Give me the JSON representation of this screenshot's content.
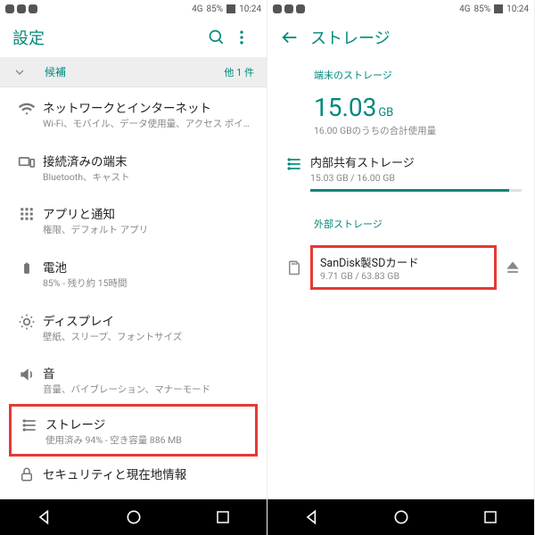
{
  "statusbar": {
    "signal": "4G",
    "battery": "85%",
    "time": "10:24"
  },
  "left": {
    "title": "設定",
    "suggestions": {
      "label": "候補",
      "more": "他 1 件"
    },
    "items": [
      {
        "title": "ネットワークとインターネット",
        "sub": "Wi-Fi、モバイル、データ使用量、アクセス ポイ…"
      },
      {
        "title": "接続済みの端末",
        "sub": "Bluetooth、キャスト"
      },
      {
        "title": "アプリと通知",
        "sub": "権限、デフォルト アプリ"
      },
      {
        "title": "電池",
        "sub": "85% - 残り約 15時間"
      },
      {
        "title": "ディスプレイ",
        "sub": "壁紙、スリープ、フォントサイズ"
      },
      {
        "title": "音",
        "sub": "音量、バイブレーション、マナーモード"
      },
      {
        "title": "ストレージ",
        "sub": "使用済み 94% - 空き容量 886 MB"
      },
      {
        "title": "セキュリティと現在地情報",
        "sub": ""
      }
    ]
  },
  "right": {
    "title": "ストレージ",
    "deviceSection": "端末のストレージ",
    "usedValue": "15.03",
    "usedUnit": "GB",
    "usedSub": "16.00 GBのうちの合計使用量",
    "internal": {
      "title": "内部共有ストレージ",
      "sub": "15.03 GB / 16.00 GB",
      "pct": 94
    },
    "externalSection": "外部ストレージ",
    "sd": {
      "title": "SanDisk製SDカード",
      "sub": "9.71 GB / 63.83 GB"
    }
  }
}
